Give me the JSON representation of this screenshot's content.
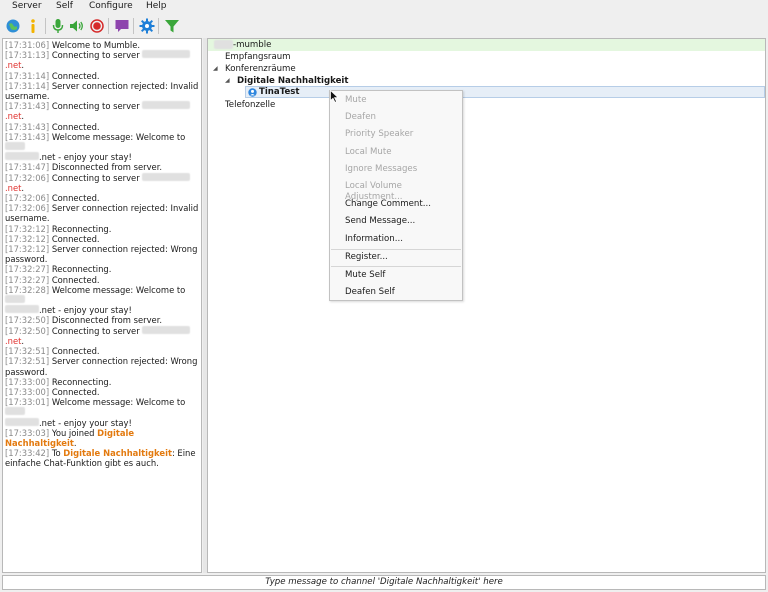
{
  "menubar": {
    "items": [
      "Server",
      "Self",
      "Configure",
      "Help"
    ]
  },
  "toolbar": {
    "buttons": [
      "globe-icon",
      "info-icon",
      "microphone-icon",
      "speaker-icon",
      "record-icon",
      "comment-icon",
      "gear-icon",
      "filter-icon"
    ]
  },
  "log": {
    "lines": [
      {
        "ts": "[17:31:06]",
        "text": " Welcome to Mumble."
      },
      {
        "ts": "[17:31:13]",
        "text": " Connecting to server ",
        "red": ".net",
        "after": "."
      },
      {
        "ts": "[17:31:14]",
        "text": " Connected."
      },
      {
        "ts": "[17:31:14]",
        "text": " Server connection rejected: Invalid username."
      },
      {
        "ts": "[17:31:43]",
        "text": " Connecting to server ",
        "red": ".net",
        "after": "."
      },
      {
        "ts": "[17:31:43]",
        "text": " Connected."
      },
      {
        "ts": "[17:31:43]",
        "text": " Welcome message: Welcome to ",
        "tail": ".net - enjoy your stay!"
      },
      {
        "ts": "[17:31:47]",
        "text": " Disconnected from server."
      },
      {
        "ts": "[17:32:06]",
        "text": " Connecting to server ",
        "red": ".net",
        "after": "."
      },
      {
        "ts": "[17:32:06]",
        "text": " Connected."
      },
      {
        "ts": "[17:32:06]",
        "text": " Server connection rejected: Invalid username."
      },
      {
        "ts": "[17:32:12]",
        "text": " Reconnecting."
      },
      {
        "ts": "[17:32:12]",
        "text": " Connected."
      },
      {
        "ts": "[17:32:12]",
        "text": " Server connection rejected: Wrong password."
      },
      {
        "ts": "[17:32:27]",
        "text": " Reconnecting."
      },
      {
        "ts": "[17:32:27]",
        "text": " Connected."
      },
      {
        "ts": "[17:32:28]",
        "text": " Welcome message: Welcome to ",
        "tail": ".net - enjoy your stay!"
      },
      {
        "ts": "[17:32:50]",
        "text": " Disconnected from server."
      },
      {
        "ts": "[17:32:50]",
        "text": " Connecting to server ",
        "red": ".net",
        "after": "."
      },
      {
        "ts": "[17:32:51]",
        "text": " Connected."
      },
      {
        "ts": "[17:32:51]",
        "text": " Server connection rejected: Wrong password."
      },
      {
        "ts": "[17:33:00]",
        "text": " Reconnecting."
      },
      {
        "ts": "[17:33:00]",
        "text": " Connected."
      },
      {
        "ts": "[17:33:01]",
        "text": " Welcome message: Welcome to ",
        "tail": ".net - enjoy your stay!"
      },
      {
        "ts": "[17:33:03]",
        "text": " You joined ",
        "orange": "Digitale Nachhaltigkeit",
        "after": "."
      },
      {
        "ts": "[17:33:42]",
        "text": " To ",
        "orange": "Digitale Nachhaltigkeit",
        "after": ": Eine einfache Chat-Funktion gibt es auch."
      }
    ]
  },
  "tree": {
    "server_suffix": "-mumble",
    "channels": [
      "Empfangsraum",
      "Konferenzräume",
      "Digitale Nachhaltigkeit",
      "Telefonzelle"
    ],
    "user": "TinaTest"
  },
  "context_menu": {
    "items": [
      {
        "label": "Mute",
        "enabled": false
      },
      {
        "label": "Deafen",
        "enabled": false
      },
      {
        "label": "Priority Speaker",
        "enabled": false
      },
      {
        "label": "Local Mute",
        "enabled": false
      },
      {
        "label": "Ignore Messages",
        "enabled": false
      },
      {
        "label": "Local Volume Adjustment...",
        "enabled": false
      },
      {
        "label": "Change Comment...",
        "enabled": true
      },
      {
        "label": "Send Message...",
        "enabled": true
      },
      {
        "label": "Information...",
        "enabled": true
      },
      {
        "label": "Register...",
        "enabled": true
      },
      {
        "label": "Mute Self",
        "enabled": true
      },
      {
        "label": "Deafen Self",
        "enabled": true
      }
    ]
  },
  "chat_input": {
    "placeholder": "Type message to channel 'Digitale Nachhaltigkeit' here"
  },
  "colors": {
    "server_row_bg": "#e4f7df",
    "link_red": "#e0312e",
    "channel_orange": "#e37a0f",
    "gear_blue": "#1e7fd8",
    "filter_green": "#3aa63a"
  }
}
